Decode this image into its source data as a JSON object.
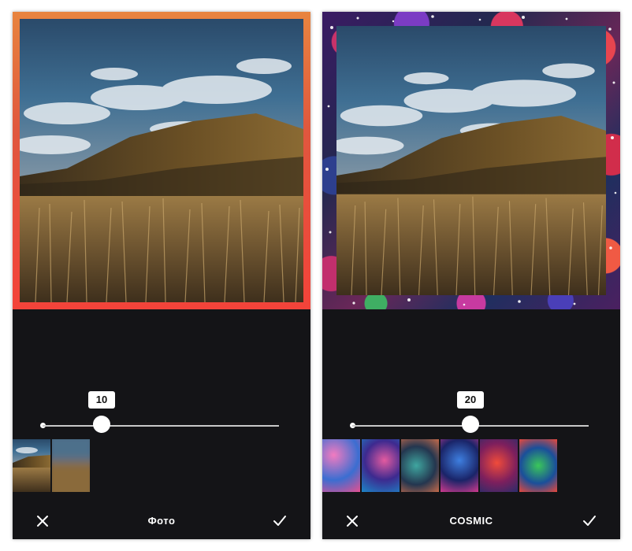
{
  "screens": [
    {
      "frame_style": "gradient",
      "slider_value": "10",
      "slider_level": 0.25,
      "thumbnails": [
        {
          "name": "photo-thumbnail-sharp"
        },
        {
          "name": "photo-thumbnail-blurred"
        }
      ],
      "title": "Фото",
      "close_icon": "close-icon",
      "confirm_icon": "checkmark-icon"
    },
    {
      "frame_style": "cosmic",
      "slider_value": "20",
      "slider_level": 0.5,
      "thumbnails": [
        {
          "name": "cosmic-thumbnail-pink"
        },
        {
          "name": "cosmic-thumbnail-blue-pink"
        },
        {
          "name": "cosmic-thumbnail-teal"
        },
        {
          "name": "cosmic-thumbnail-blue"
        },
        {
          "name": "cosmic-thumbnail-red"
        },
        {
          "name": "cosmic-thumbnail-green"
        }
      ],
      "title": "COSMIC",
      "close_icon": "close-icon",
      "confirm_icon": "checkmark-icon"
    }
  ],
  "colors": {
    "panel_bg": "#141417",
    "frame_gradient_top": "#e8843f",
    "frame_gradient_bottom": "#f3433a",
    "slider_track": "#c9c9c9",
    "text": "#ffffff"
  }
}
